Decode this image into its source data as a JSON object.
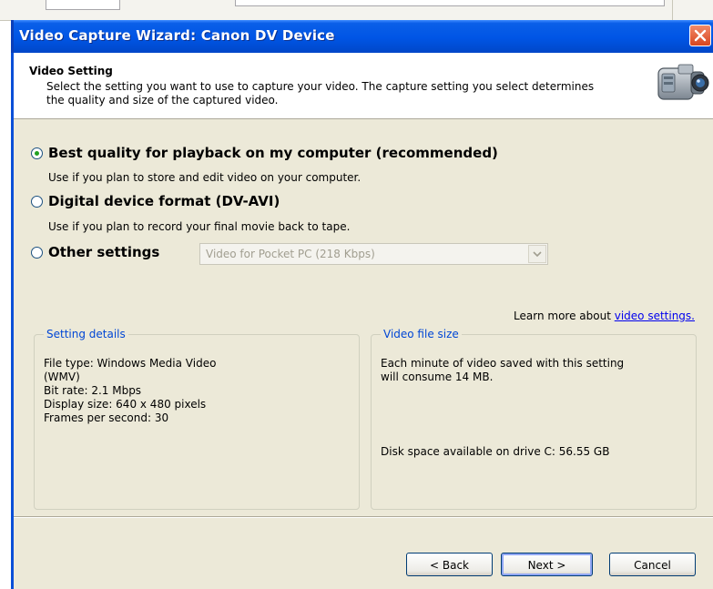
{
  "window": {
    "title": "Video Capture Wizard: Canon DV Device"
  },
  "header": {
    "title": "Video Setting",
    "description": "Select the setting you want to use to capture your video. The capture setting you select determines the quality and size of the captured video."
  },
  "options": [
    {
      "label": "Best quality for playback on my computer (recommended)",
      "description": "Use if you plan to store and edit video on your computer.",
      "selected": true
    },
    {
      "label": "Digital device format (DV-AVI)",
      "description": "Use if you plan to record your final movie back to tape.",
      "selected": false
    },
    {
      "label": "Other settings",
      "selected": false
    }
  ],
  "other_settings_select": {
    "value": "Video for Pocket PC (218 Kbps)"
  },
  "learn_more": {
    "prefix": "Learn more about ",
    "link_text": "video settings."
  },
  "setting_details": {
    "legend": "Setting details",
    "file_type_line1": "File type: Windows Media Video",
    "file_type_line2": "(WMV)",
    "bit_rate": "Bit rate: 2.1 Mbps",
    "display_size": "Display size: 640 x 480 pixels",
    "fps": "Frames per second: 30"
  },
  "video_file_size": {
    "legend": "Video file size",
    "line1": "Each minute of video saved with this setting",
    "line2": "will consume 14 MB.",
    "disk_space": "Disk space available on drive C: 56.55 GB"
  },
  "buttons": {
    "back": "< Back",
    "next": "Next >",
    "cancel": "Cancel"
  },
  "colors": {
    "titlebar": "#0055e5",
    "legend_text": "#0046d5",
    "link": "#0000ee",
    "dialog_bg": "#ece9d8"
  },
  "icons": {
    "header": "camcorder-icon",
    "close": "close-icon"
  }
}
